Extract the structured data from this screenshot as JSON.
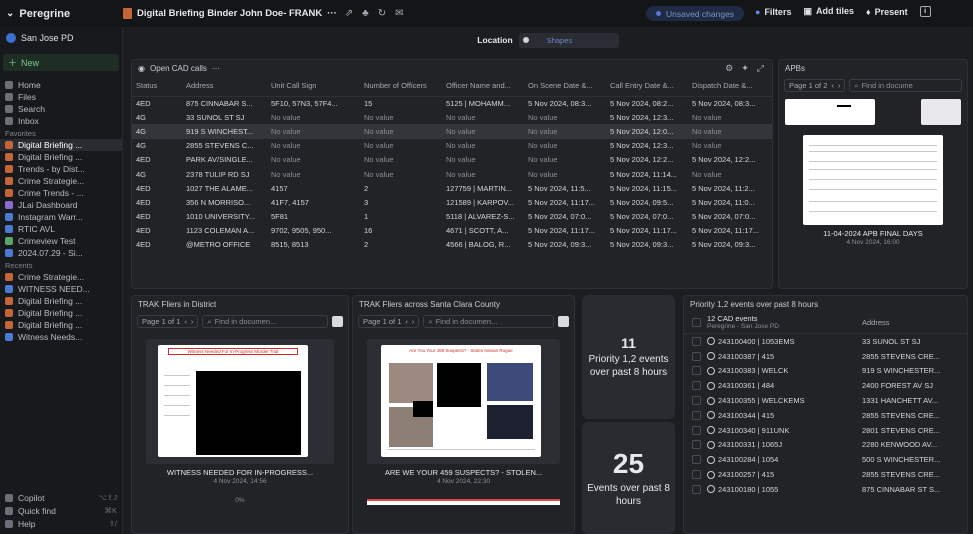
{
  "app": {
    "name": "Peregrine",
    "doc_title": "Digital Briefing Binder John Doe- FRANK",
    "unsaved": "Unsaved changes"
  },
  "toolbar": {
    "filters": "Filters",
    "add_tiles": "Add tiles",
    "present": "Present"
  },
  "sidebar": {
    "workspace": "San Jose PD",
    "new_label": "New",
    "main_items": [
      {
        "label": "Home"
      },
      {
        "label": "Files"
      },
      {
        "label": "Search"
      },
      {
        "label": "Inbox"
      }
    ],
    "favorites_label": "Favorites",
    "favorites": [
      {
        "label": "Digital Briefing ..."
      },
      {
        "label": "Digital Briefing ..."
      },
      {
        "label": "Trends - by Dist..."
      },
      {
        "label": "Crime Strategie..."
      },
      {
        "label": "Crime Trends - ..."
      },
      {
        "label": "JLai Dashboard"
      },
      {
        "label": "Instagram Warr..."
      },
      {
        "label": "RTIC AVL"
      },
      {
        "label": "Crimeview Test"
      },
      {
        "label": "2024.07.29 - Si..."
      }
    ],
    "recents_label": "Recents",
    "recents": [
      {
        "label": "Crime Strategie..."
      },
      {
        "label": "WITNESS NEED..."
      },
      {
        "label": "Digital Briefing ..."
      },
      {
        "label": "Digital Briefing ..."
      },
      {
        "label": "Digital Briefing ..."
      },
      {
        "label": "Witness Needs..."
      }
    ],
    "bottom": [
      {
        "label": "Copilot",
        "kbd": "⌥⇧J"
      },
      {
        "label": "Quick find",
        "kbd": "⌘K"
      },
      {
        "label": "Help",
        "kbd": "⇧/"
      }
    ]
  },
  "location": {
    "label": "Location",
    "value": "Shapes"
  },
  "cad": {
    "title": "Open CAD calls",
    "columns": [
      "Status",
      "Address",
      "Unit Call Sign",
      "Number of Officers",
      "Officer Name and...",
      "On Scene Date &...",
      "Call Entry Date &...",
      "Dispatch Date &..."
    ],
    "rows": [
      [
        "4ED",
        "875 CINNABAR S...",
        "5F10, 57N3, 57F4...",
        "15",
        "5125 | MOHAMM...",
        "5 Nov 2024, 08:3...",
        "5 Nov 2024, 08:2...",
        "5 Nov 2024, 08:3..."
      ],
      [
        "4G",
        "33 SUNOL ST SJ",
        "No value",
        "No value",
        "No value",
        "No value",
        "5 Nov 2024, 12:3...",
        "No value"
      ],
      [
        "4G",
        "919 S WINCHEST...",
        "No value",
        "No value",
        "No value",
        "No value",
        "5 Nov 2024, 12:0...",
        "No value"
      ],
      [
        "4G",
        "2855 STEVENS C...",
        "No value",
        "No value",
        "No value",
        "No value",
        "5 Nov 2024, 12:3...",
        "No value"
      ],
      [
        "4ED",
        "PARK AV/SINGLE...",
        "No value",
        "No value",
        "No value",
        "No value",
        "5 Nov 2024, 12:2...",
        "5 Nov 2024, 12:2..."
      ],
      [
        "4G",
        "2378 TULIP RD SJ",
        "No value",
        "No value",
        "No value",
        "No value",
        "5 Nov 2024, 11:14...",
        "No value"
      ],
      [
        "4ED",
        "1027 THE ALAME...",
        "4157",
        "2",
        "127759 | MARTIN...",
        "5 Nov 2024, 11:5...",
        "5 Nov 2024, 11:15...",
        "5 Nov 2024, 11:2..."
      ],
      [
        "4ED",
        "356 N MORRISO...",
        "41F7, 4157",
        "3",
        "121589 | KARPOV...",
        "5 Nov 2024, 11:17...",
        "5 Nov 2024, 09:5...",
        "5 Nov 2024, 11:0..."
      ],
      [
        "4ED",
        "1010 UNIVERSITY...",
        "5F81",
        "1",
        "5118 | ALVAREZ-S...",
        "5 Nov 2024, 07:0...",
        "5 Nov 2024, 07:0...",
        "5 Nov 2024, 07:0..."
      ],
      [
        "4ED",
        "1123 COLEMAN A...",
        "9702, 9505, 950...",
        "16",
        "4671 | SCOTT, A...",
        "5 Nov 2024, 11:17...",
        "5 Nov 2024, 11:17...",
        "5 Nov 2024, 11:17..."
      ],
      [
        "4ED",
        "@METRO OFFICE",
        "8515, 8513",
        "2",
        "4566 | BALOG, R...",
        "5 Nov 2024, 09:3...",
        "5 Nov 2024, 09:3...",
        "5 Nov 2024, 09:3..."
      ]
    ]
  },
  "apbs": {
    "title": "APBs",
    "page": "Page 1 of 2",
    "find": "Find in docume",
    "doc_title": "11-04-2024 APB FINAL DAYS",
    "doc_date": "4 Nov 2024, 16:00"
  },
  "trak1": {
    "title": "TRAK Fliers in District",
    "page": "Page 1 of 1",
    "find": "Find in documen...",
    "doc_header": "Witness Needed For In-Progress Murder Trial",
    "doc_title": "WITNESS NEEDED FOR IN-PROGRESS...",
    "doc_date": "4 Nov 2024, 14:56",
    "zoom": "0%"
  },
  "trak2": {
    "title": "TRAK Fliers across Santa Clara County",
    "page": "Page 1 of 1",
    "find": "Find in documen...",
    "doc_header": "Are You Your 459 Suspects? - Stolen Nissan Rogue",
    "doc_title": "ARE WE YOUR 459 SUSPECTS? - STOLEN...",
    "doc_date": "4 Nov 2024, 22:30"
  },
  "stats": [
    {
      "num": "11",
      "label": "Priority 1,2 events over past 8 hours"
    },
    {
      "num": "25",
      "label": "Events over past 8 hours"
    }
  ],
  "priority": {
    "title": "Priority 1,2 events over past 8 hours",
    "count_label": "12 CAD events",
    "count_sub": "Peregrine - San Jose PD",
    "col_address": "Address",
    "rows": [
      {
        "id": "243100400 | 1053EMS",
        "addr": "33 SUNOL ST SJ"
      },
      {
        "id": "243100387 | 415",
        "addr": "2855 STEVENS CRE..."
      },
      {
        "id": "243100383 | WELCK",
        "addr": "919 S WINCHESTER..."
      },
      {
        "id": "243100361 | 484",
        "addr": "2400 FOREST AV SJ"
      },
      {
        "id": "243100355 | WELCKEMS",
        "addr": "1331 HANCHETT AV..."
      },
      {
        "id": "243100344 | 415",
        "addr": "2855 STEVENS CRE..."
      },
      {
        "id": "243100340 | 911UNK",
        "addr": "2801 STEVENS CRE..."
      },
      {
        "id": "243100331 | 1065J",
        "addr": "2280 KENWOOD AV..."
      },
      {
        "id": "243100284 | 1054",
        "addr": "500 S WINCHESTER..."
      },
      {
        "id": "243100257 | 415",
        "addr": "2855 STEVENS CRE..."
      },
      {
        "id": "243100180 | 1055",
        "addr": "875 CINNABAR ST S..."
      }
    ]
  }
}
